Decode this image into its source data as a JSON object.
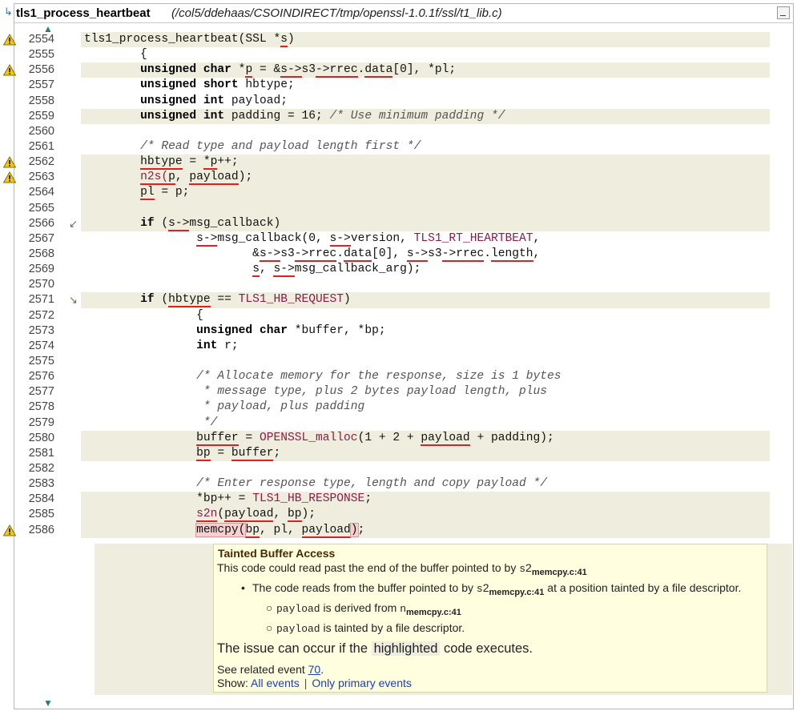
{
  "header": {
    "function_name": "tls1_process_heartbeat",
    "file_path": "(/col5/ddehaas/CSOINDIRECT/tmp/openssl-1.0.1f/ssl/t1_lib.c)"
  },
  "lines": [
    {
      "n": "2554",
      "warn": true,
      "hl": true,
      "html": "tls1_process_heartbeat(SSL *<span class=\"u\">s</span>)"
    },
    {
      "n": "2555",
      "html": "        {"
    },
    {
      "n": "2556",
      "warn": true,
      "hl": true,
      "html": "        <span class=\"kw\">unsigned char</span> *<span class=\"u\">p</span> = &amp;<span class=\"u\">s-&gt;</span>s3<span class=\"u\">-&gt;</span><span class=\"u\">rrec</span>.<span class=\"u\">data</span>[0], *pl;"
    },
    {
      "n": "2557",
      "html": "        <span class=\"kw\">unsigned short</span> hbtype;"
    },
    {
      "n": "2558",
      "html": "        <span class=\"kw\">unsigned int</span> payload;"
    },
    {
      "n": "2559",
      "hl": true,
      "html": "        <span class=\"kw\">unsigned int</span> padding = 16; <span class=\"cm\">/* Use minimum padding */</span>"
    },
    {
      "n": "2560",
      "html": ""
    },
    {
      "n": "2561",
      "html": "        <span class=\"cm\">/* Read type and payload length first */</span>"
    },
    {
      "n": "2562",
      "warn": true,
      "hl": true,
      "html": "        <span class=\"u\">hbtype</span> = <span class=\"u\">*p</span>++;"
    },
    {
      "n": "2563",
      "warn": true,
      "hl": true,
      "html": "        <span class=\"mac u\">n2s(</span><span class=\"u\">p</span>, <span class=\"u\">payload</span>);"
    },
    {
      "n": "2564",
      "hl": true,
      "html": "        <span class=\"u\">pl</span> = p;"
    },
    {
      "n": "2565",
      "hl": true,
      "html": ""
    },
    {
      "n": "2566",
      "gut": "↙",
      "hl": true,
      "html": "        <span class=\"kw\">if</span> (<span class=\"u\">s-&gt;</span>msg_callback)"
    },
    {
      "n": "2567",
      "html": "                <span class=\"u\">s-&gt;</span>msg_callback(0, <span class=\"u\">s-&gt;</span>version, <span class=\"mac\">TLS1_RT_HEARTBEAT</span>,"
    },
    {
      "n": "2568",
      "html": "                        &amp;<span class=\"u\">s-&gt;</span>s3<span class=\"u\">-&gt;</span><span class=\"u\">rrec</span>.<span class=\"u\">data</span>[0], <span class=\"u\">s-&gt;</span>s3<span class=\"u\">-&gt;</span><span class=\"u\">rrec</span>.<span class=\"u\">length</span>,"
    },
    {
      "n": "2569",
      "html": "                        <span class=\"u\">s</span>, <span class=\"u\">s-&gt;</span>msg_callback_arg);"
    },
    {
      "n": "2570",
      "html": ""
    },
    {
      "n": "2571",
      "gut": "↘",
      "hl": true,
      "html": "        <span class=\"kw\">if</span> (<span class=\"u\">hbtype</span> == <span class=\"mac\">TLS1_HB_REQUEST</span>)"
    },
    {
      "n": "2572",
      "html": "                {"
    },
    {
      "n": "2573",
      "html": "                <span class=\"kw\">unsigned char</span> *buffer, *bp;"
    },
    {
      "n": "2574",
      "html": "                <span class=\"kw\">int</span> r;"
    },
    {
      "n": "2575",
      "html": ""
    },
    {
      "n": "2576",
      "html": "                <span class=\"cm\">/* Allocate memory for the response, size is 1 bytes</span>"
    },
    {
      "n": "2577",
      "html": "                <span class=\"cm\"> * message type, plus 2 bytes payload length, plus</span>"
    },
    {
      "n": "2578",
      "html": "                <span class=\"cm\"> * payload, plus padding</span>"
    },
    {
      "n": "2579",
      "html": "                <span class=\"cm\"> */</span>"
    },
    {
      "n": "2580",
      "hl": true,
      "html": "                <span class=\"u\">buffer</span> = <span class=\"mac\">OPENSSL_malloc</span>(1 + 2 + <span class=\"u\">payload</span> + padding);"
    },
    {
      "n": "2581",
      "hl": true,
      "html": "                <span class=\"u\">bp</span> = <span class=\"u\">buffer</span>;"
    },
    {
      "n": "2582",
      "html": ""
    },
    {
      "n": "2583",
      "html": "                <span class=\"cm\">/* Enter response type, length and copy payload */</span>"
    },
    {
      "n": "2584",
      "hl": true,
      "html": "                *bp++ = <span class=\"mac\">TLS1_HB_RESPONSE</span>;"
    },
    {
      "n": "2585",
      "hl": true,
      "html": "                <span class=\"mac u\">s2n</span>(<span class=\"u\">payload</span>, <span class=\"u\">bp</span>);"
    },
    {
      "n": "2586",
      "warn": true,
      "hl": true,
      "html": "                <span class=\"bx\">memcpy(</span><span class=\"u\">bp</span>, pl, <span class=\"u\">payload</span><span class=\"bx\">)</span>;"
    }
  ],
  "popup": {
    "title": "Tainted Buffer Access",
    "line1_pre": "This code could read past the end of the buffer pointed to by ",
    "line1_var": "s",
    "line1_sup": "2",
    "line1_sub": "memcpy.c:41",
    "line2_pre": "The code reads from the buffer pointed to by ",
    "line2_var": "s",
    "line2_sup": "2",
    "line2_sub": "memcpy.c:41",
    "line2_post": " at a position tainted by a file descriptor.",
    "line3_var": "payload",
    "line3_mid": " is derived from ",
    "line3_var2": "n",
    "line3_sub": "memcpy.c:41",
    "line4_var": "payload",
    "line4_post": " is tainted by a file descriptor.",
    "issue_pre": "The issue can occur if the ",
    "issue_hl": "highlighted",
    "issue_post": " code executes.",
    "related_pre": "See related event ",
    "related_link": "70",
    "show_label": "Show:",
    "all_events": "All events",
    "primary_events": "Only primary events"
  }
}
